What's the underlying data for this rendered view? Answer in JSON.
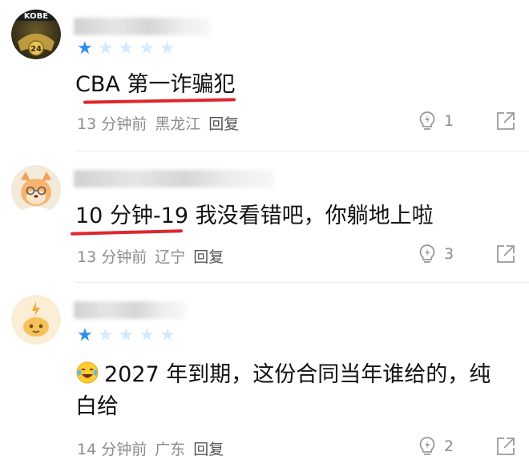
{
  "comments": [
    {
      "avatar_icon": "kobe-24-badge-avatar",
      "avatar_logo_text": "KOBE",
      "avatar_number": "24",
      "rating": 1,
      "text": "CBA 第一诈骗犯",
      "time": "13 分钟前",
      "location": "黑龙江",
      "reply_label": "回复",
      "likes": "1",
      "underline_color": "#e0262d"
    },
    {
      "avatar_icon": "cartoon-dog-avatar",
      "rating": null,
      "text": "10 分钟-19 我没看错吧，你躺地上啦",
      "time": "13 分钟前",
      "location": "辽宁",
      "reply_label": "回复",
      "likes": "3",
      "underline_color": "#e0262d"
    },
    {
      "avatar_icon": "lightning-bot-avatar",
      "rating": 1,
      "text_emoji": "laughing-crying-emoji",
      "text": "2027 年到期，这份合同当年谁给的，纯白给",
      "time": "14 分钟前",
      "location": "广东",
      "reply_label": "回复",
      "likes": "2"
    }
  ],
  "icons": {
    "like": "lightbulb-like-icon",
    "share": "share-arrow-icon",
    "star_on_color": "#2d8ef0",
    "star_off_color": "#d6eaf9"
  }
}
